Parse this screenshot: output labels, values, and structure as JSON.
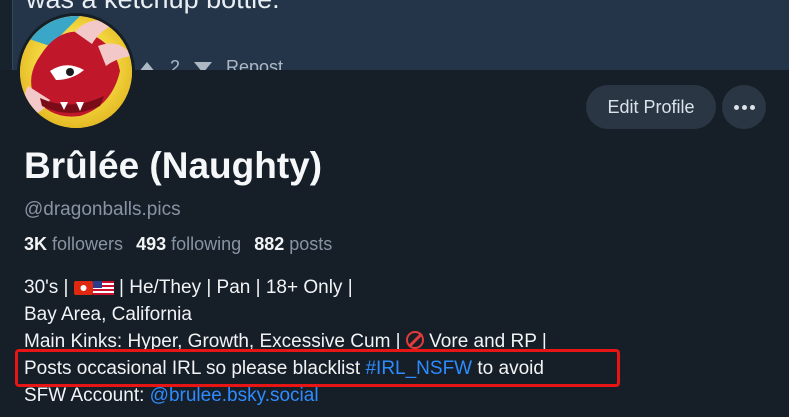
{
  "banner": {
    "post_text": "was a ketchup bottle.",
    "repost_label": "Repost",
    "reply_count": "2"
  },
  "profile": {
    "edit_label": "Edit Profile",
    "display_name": "Brûlée (Naughty)",
    "handle": "@dragonballs.pics",
    "stats": {
      "followers_count": "3K",
      "followers_label": "followers",
      "following_count": "493",
      "following_label": "following",
      "posts_count": "882",
      "posts_label": "posts"
    },
    "bio": {
      "line1_a": "30's |",
      "line1_b": "| He/They | Pan | 18+ Only |",
      "line2": "Bay Area, California",
      "line3_a": "Main Kinks: Hyper, Growth, Excessive Cum |",
      "line3_b": "Vore and RP |",
      "line4_a": "Posts occasional IRL so please blacklist",
      "line4_tag": "#IRL_NSFW",
      "line4_b": "to avoid",
      "line5_a": "SFW Account:",
      "line5_link": "@brulee.bsky.social"
    }
  },
  "colors": {
    "background": "#161e27",
    "link": "#2d8cff",
    "highlight_border": "#e81515"
  }
}
